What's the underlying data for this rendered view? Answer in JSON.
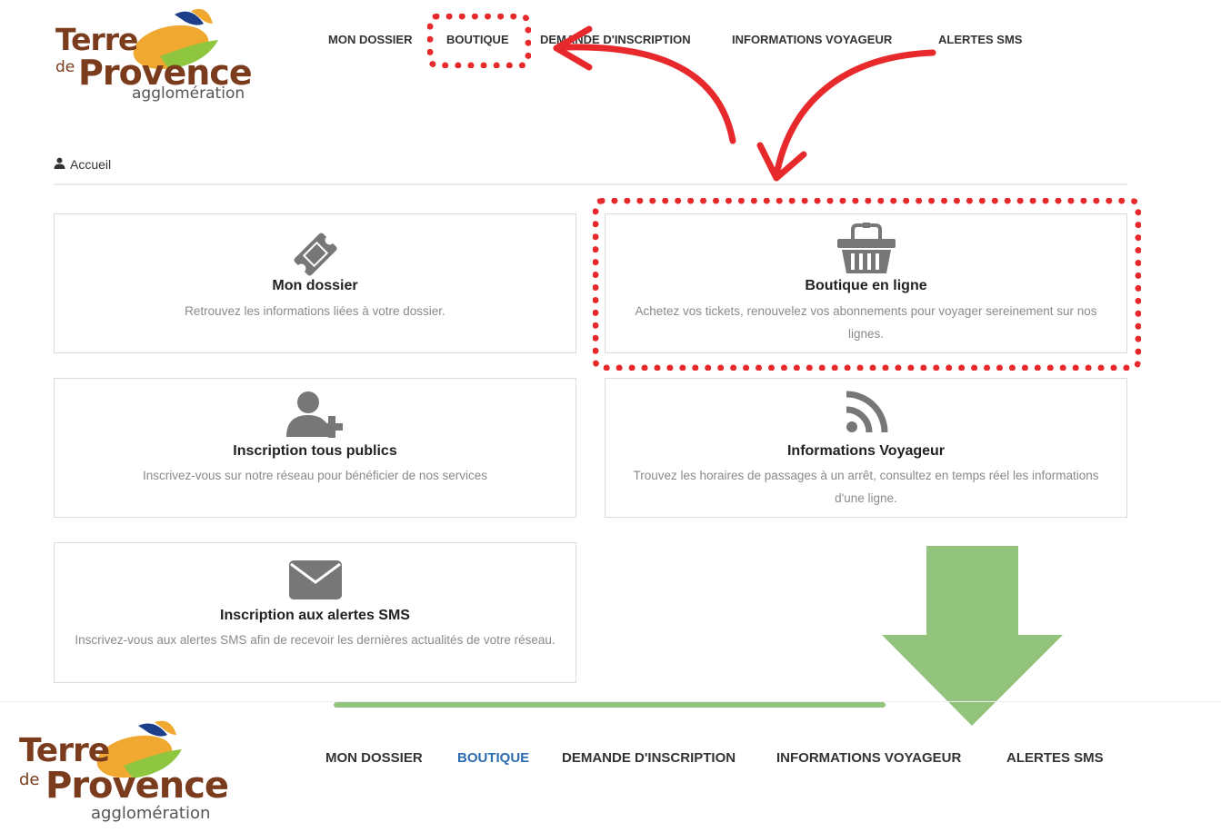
{
  "logo": {
    "word1": "Terre",
    "word2": "de",
    "word3": "Provence",
    "word4": "agglomération"
  },
  "nav": {
    "items": [
      {
        "label": "MON DOSSIER"
      },
      {
        "label": "BOUTIQUE"
      },
      {
        "label": "DEMANDE D'INSCRIPTION"
      },
      {
        "label": "INFORMATIONS VOYAGEUR"
      },
      {
        "label": "ALERTES SMS"
      }
    ],
    "active": "BOUTIQUE"
  },
  "breadcrumb": {
    "icon": "user-icon",
    "label": "Accueil"
  },
  "cards": [
    {
      "icon": "ticket-icon",
      "title": "Mon dossier",
      "desc": "Retrouvez les informations liées à votre dossier."
    },
    {
      "icon": "basket-icon",
      "title": "Boutique en ligne",
      "desc": "Achetez vos tickets, renouvelez vos abonnements pour voyager sereinement sur nos lignes."
    },
    {
      "icon": "user-plus-icon",
      "title": "Inscription tous publics",
      "desc": "Inscrivez-vous sur notre réseau pour bénéficier de nos services"
    },
    {
      "icon": "rss-icon",
      "title": "Informations Voyageur",
      "desc": "Trouvez les horaires de passages à un arrêt, consultez en temps réel les informations d'une ligne."
    },
    {
      "icon": "envelope-icon",
      "title": "Inscription aux alertes SMS",
      "desc": "Inscrivez-vous aux alertes SMS afin de recevoir les dernières actualités de votre réseau."
    }
  ],
  "colors": {
    "annotation_red": "#e8292b",
    "annotation_green": "#93c47d",
    "active_link": "#2c6cb0",
    "logo_brown": "#7a3c1c",
    "logo_orange": "#f0a830",
    "logo_green": "#8fc63f",
    "logo_blue": "#1d3f8a"
  }
}
